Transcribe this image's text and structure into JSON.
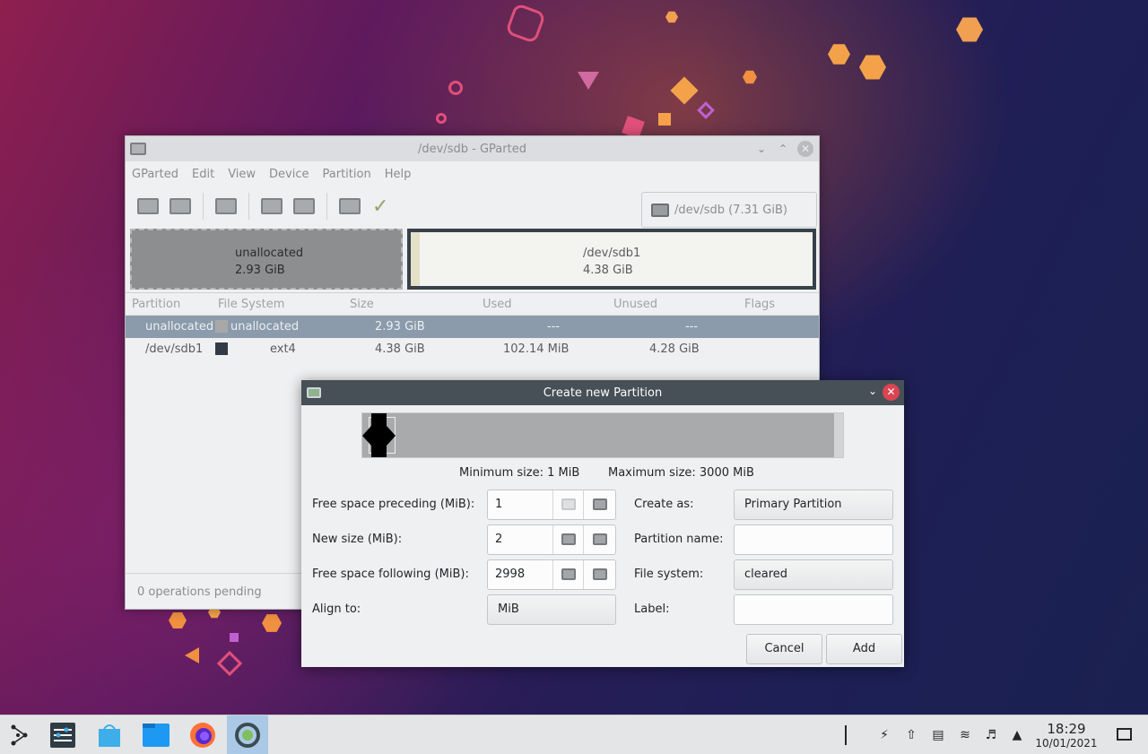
{
  "gparted": {
    "title": "/dev/sdb - GParted",
    "menu": [
      "GParted",
      "Edit",
      "View",
      "Device",
      "Partition",
      "Help"
    ],
    "device_selector": "/dev/sdb (7.31 GiB)",
    "visual": {
      "unallocated_label": "unallocated",
      "unallocated_size": "2.93 GiB",
      "sdb1_label": "/dev/sdb1",
      "sdb1_size": "4.38 GiB"
    },
    "columns": [
      "Partition",
      "File System",
      "Size",
      "Used",
      "Unused",
      "Flags"
    ],
    "rows": [
      {
        "partition": "unallocated",
        "filesystem": "unallocated",
        "size": "2.93 GiB",
        "used": "---",
        "unused": "---",
        "flags": "",
        "fs_color": "#a8a8a8"
      },
      {
        "partition": "/dev/sdb1",
        "filesystem": "ext4",
        "size": "4.38 GiB",
        "used": "102.14 MiB",
        "unused": "4.28 GiB",
        "flags": "",
        "fs_color": "#313a45"
      }
    ],
    "status": "0 operations pending"
  },
  "dialog": {
    "title": "Create new Partition",
    "min_size": "Minimum size: 1 MiB",
    "max_size": "Maximum size: 3000 MiB",
    "free_preceding_label": "Free space preceding (MiB):",
    "free_preceding_value": "1",
    "new_size_label": "New size (MiB):",
    "new_size_value": "2",
    "free_following_label": "Free space following (MiB):",
    "free_following_value": "2998",
    "align_label": "Align to:",
    "align_value": "MiB",
    "create_as_label": "Create as:",
    "create_as_value": "Primary Partition",
    "partition_name_label": "Partition name:",
    "partition_name_value": "",
    "file_system_label": "File system:",
    "file_system_value": "cleared",
    "label_label": "Label:",
    "label_value": "",
    "cancel": "Cancel",
    "add": "Add"
  },
  "taskbar": {
    "time": "18:29",
    "date": "10/01/2021"
  }
}
